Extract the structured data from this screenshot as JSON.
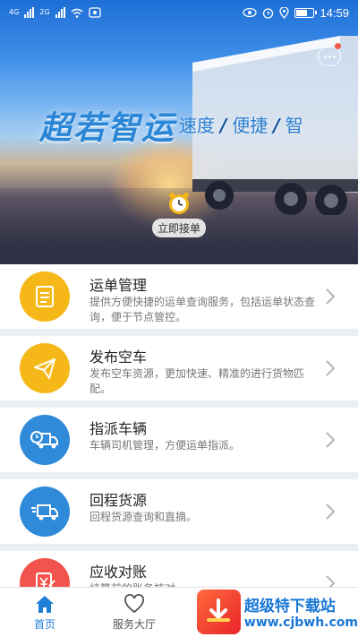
{
  "status_bar": {
    "left_labels": [
      "4G",
      "2G"
    ],
    "time": "14:59",
    "icons": [
      "signal-icon",
      "wifi-icon",
      "notification-icon",
      "eye-icon",
      "alarm-icon",
      "location-icon",
      "battery-icon"
    ]
  },
  "hero": {
    "brand": "超若智运",
    "slogan": [
      "速度",
      "便捷",
      "智"
    ],
    "slogan_separator": "/",
    "accept_label": "立即接单"
  },
  "menu": [
    {
      "title": "运单管理",
      "desc": "提供方便快捷的运单查询服务，包括运单状态查询，便于节点管控。",
      "icon": "document-icon",
      "color": "#f5b818"
    },
    {
      "title": "发布空车",
      "desc": "发布空车资源，更加快速、精准的进行货物匹配。",
      "icon": "paper-plane-icon",
      "color": "#f5b818"
    },
    {
      "title": "指派车辆",
      "desc": "车辆司机管理，方便运单指派。",
      "icon": "truck-clock-icon",
      "color": "#2f8ad9"
    },
    {
      "title": "回程货源",
      "desc": "回程货源查询和直摘。",
      "icon": "truck-fast-icon",
      "color": "#2f8ad9"
    },
    {
      "title": "应收对账",
      "desc": "结算前的账务核对",
      "icon": "bill-yen-icon",
      "color": "#f2544d"
    }
  ],
  "tabs": [
    {
      "label": "首页",
      "icon": "home-icon",
      "active": true
    },
    {
      "label": "服务大厅",
      "icon": "heart-icon",
      "active": false
    }
  ],
  "watermark": {
    "line1": "超级特下载站",
    "line2": "www.cjbwh.com"
  },
  "colors": {
    "accent": "#1f7fd6",
    "yellow": "#f5b818",
    "red": "#f2544d",
    "blue": "#2f8ad9"
  }
}
